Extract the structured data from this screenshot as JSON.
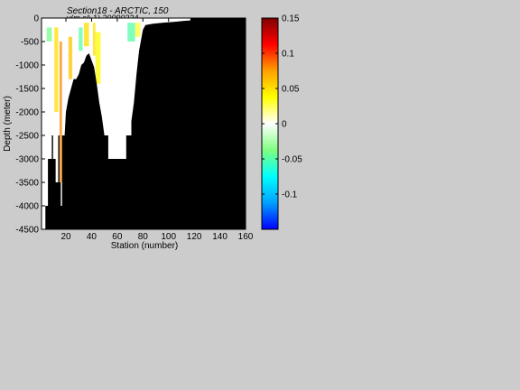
{
  "chart_data": {
    "type": "heatmap",
    "title": "Section18 - ARCTIC, 150",
    "subtitle": "v(m s^-1) 20090324",
    "xlabel": "Station (number)",
    "ylabel": "Depth (meter)",
    "xlim": [
      1,
      160
    ],
    "ylim": [
      -4500,
      0
    ],
    "xticks": [
      20,
      40,
      60,
      80,
      100,
      120,
      140,
      160
    ],
    "yticks": [
      0,
      -500,
      -1000,
      -1500,
      -2000,
      -2500,
      -3000,
      -3500,
      -4000,
      -4500
    ],
    "colorbar": {
      "range": [
        -0.15,
        0.15
      ],
      "ticks": [
        0.15,
        0.1,
        0.05,
        0,
        -0.05,
        -0.1
      ],
      "tick_labels": [
        "0.15",
        "0.1",
        "0.05",
        "0",
        "-0.05",
        "-0.1"
      ],
      "colormap": [
        "#0000ff",
        "#00a0ff",
        "#00ffff",
        "#80ff80",
        "#ffffff",
        "#ffff00",
        "#ffa000",
        "#ff0000",
        "#800000"
      ]
    },
    "bathymetry": [
      [
        1,
        -4500
      ],
      [
        4,
        -4500
      ],
      [
        4,
        -4000
      ],
      [
        6,
        -4000
      ],
      [
        6,
        -3000
      ],
      [
        9,
        -3000
      ],
      [
        9,
        -2500
      ],
      [
        10,
        -2500
      ],
      [
        10,
        -3000
      ],
      [
        12,
        -3000
      ],
      [
        12,
        -3500
      ],
      [
        14,
        -3500
      ],
      [
        14,
        -2500
      ],
      [
        15,
        -2500
      ],
      [
        15,
        -3500
      ],
      [
        16,
        -3500
      ],
      [
        16,
        -4000
      ],
      [
        17,
        -4000
      ],
      [
        17,
        -2500
      ],
      [
        19,
        -2500
      ],
      [
        20,
        -2000
      ],
      [
        22,
        -1700
      ],
      [
        24,
        -1500
      ],
      [
        26,
        -1300
      ],
      [
        28,
        -1300
      ],
      [
        30,
        -1200
      ],
      [
        32,
        -1000
      ],
      [
        34,
        -950
      ],
      [
        36,
        -800
      ],
      [
        38,
        -750
      ],
      [
        40,
        -900
      ],
      [
        42,
        -1050
      ],
      [
        44,
        -1400
      ],
      [
        46,
        -1800
      ],
      [
        48,
        -2100
      ],
      [
        50,
        -2500
      ],
      [
        53,
        -2500
      ],
      [
        53,
        -3000
      ],
      [
        67,
        -3000
      ],
      [
        67,
        -2500
      ],
      [
        71,
        -2500
      ],
      [
        71,
        -2200
      ],
      [
        73,
        -1800
      ],
      [
        75,
        -1200
      ],
      [
        77,
        -700
      ],
      [
        80,
        -250
      ],
      [
        82,
        -150
      ],
      [
        88,
        -120
      ],
      [
        95,
        -100
      ],
      [
        105,
        -80
      ],
      [
        112,
        -60
      ],
      [
        117,
        -50
      ],
      [
        117,
        0
      ],
      [
        160,
        0
      ],
      [
        160,
        -4500
      ]
    ],
    "velocity_features": [
      {
        "x": [
          5,
          9
        ],
        "depth": [
          -200,
          -500
        ],
        "value": -0.04
      },
      {
        "x": [
          11,
          14
        ],
        "depth": [
          -200,
          -2000
        ],
        "value": 0.05
      },
      {
        "x": [
          15,
          17
        ],
        "depth": [
          -500,
          -3500
        ],
        "value": 0.08
      },
      {
        "x": [
          22,
          25
        ],
        "depth": [
          -400,
          -1300
        ],
        "value": 0.06
      },
      {
        "x": [
          30,
          33
        ],
        "depth": [
          -200,
          -700
        ],
        "value": -0.05
      },
      {
        "x": [
          34,
          38
        ],
        "depth": [
          -100,
          -600
        ],
        "value": 0.05
      },
      {
        "x": [
          41,
          43
        ],
        "depth": [
          -100,
          -800
        ],
        "value": 0.05
      },
      {
        "x": [
          43,
          47
        ],
        "depth": [
          -300,
          -1400
        ],
        "value": 0.04
      },
      {
        "x": [
          68,
          74
        ],
        "depth": [
          -100,
          -500
        ],
        "value": -0.05
      },
      {
        "x": [
          74,
          78
        ],
        "depth": [
          -100,
          -400
        ],
        "value": 0.03
      }
    ]
  }
}
